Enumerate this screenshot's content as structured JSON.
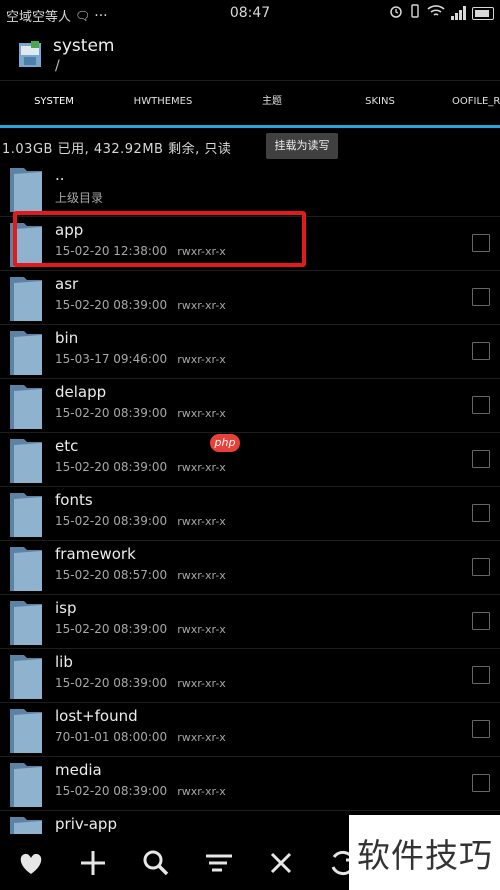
{
  "status_bar": {
    "carrier": "空域空等人",
    "time": "08:47"
  },
  "header": {
    "title": "system",
    "path": "/"
  },
  "tabs": [
    {
      "label": "SYSTEM",
      "active": true
    },
    {
      "label": "HWTHEMES",
      "active": false
    },
    {
      "label": "主题",
      "active": false
    },
    {
      "label": "SKINS",
      "active": false
    },
    {
      "label": "OOFILE_RE",
      "active": false
    }
  ],
  "storage": {
    "info": "1.03GB 已用, 432.92MB 剩余, 只读",
    "mount_button": "挂载为读写"
  },
  "files": [
    {
      "name": "..",
      "meta": "上级目录",
      "perm": ""
    },
    {
      "name": "app",
      "meta": "15-02-20 12:38:00",
      "perm": "rwxr-xr-x"
    },
    {
      "name": "asr",
      "meta": "15-02-20 08:39:00",
      "perm": "rwxr-xr-x"
    },
    {
      "name": "bin",
      "meta": "15-03-17 09:46:00",
      "perm": "rwxr-xr-x"
    },
    {
      "name": "delapp",
      "meta": "15-02-20 08:39:00",
      "perm": "rwxr-xr-x"
    },
    {
      "name": "etc",
      "meta": "15-02-20 08:39:00",
      "perm": "rwxr-xr-x"
    },
    {
      "name": "fonts",
      "meta": "15-02-20 08:39:00",
      "perm": "rwxr-xr-x"
    },
    {
      "name": "framework",
      "meta": "15-02-20 08:57:00",
      "perm": "rwxr-xr-x"
    },
    {
      "name": "isp",
      "meta": "15-02-20 08:39:00",
      "perm": "rwxr-xr-x"
    },
    {
      "name": "lib",
      "meta": "15-02-20 08:39:00",
      "perm": "rwxr-xr-x"
    },
    {
      "name": "lost+found",
      "meta": "70-01-01 08:00:00",
      "perm": "rwxr-xr-x"
    },
    {
      "name": "media",
      "meta": "15-02-20 08:39:00",
      "perm": "rwxr-xr-x"
    },
    {
      "name": "priv-app",
      "meta": "",
      "perm": ""
    }
  ],
  "bottom_bar": {
    "icons": [
      "heart-icon",
      "plus-icon",
      "search-icon",
      "sort-icon",
      "close-icon",
      "refresh-icon"
    ]
  },
  "watermarks": {
    "php": "php",
    "site": "软件技巧"
  },
  "colors": {
    "accent": "#2aa3d6",
    "highlight": "#e11b1b",
    "folder": "#8fb2cf"
  }
}
